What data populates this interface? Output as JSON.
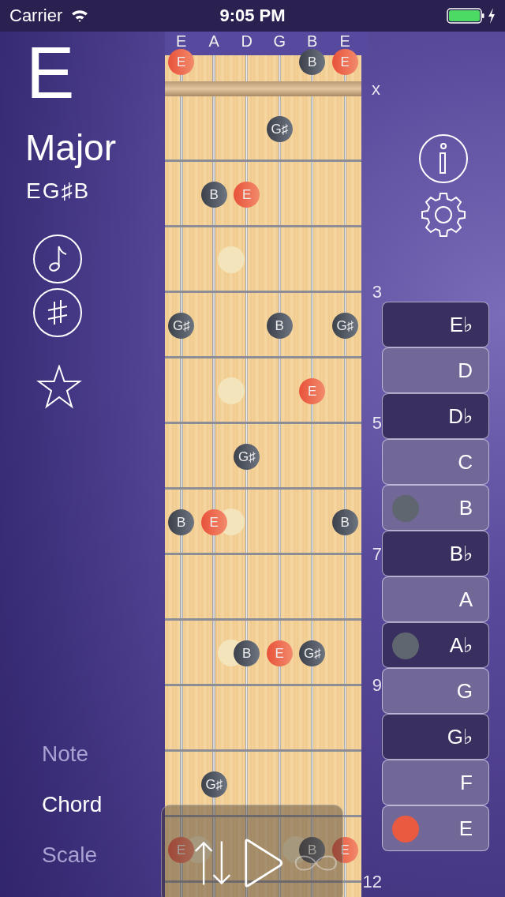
{
  "status_bar": {
    "carrier": "Carrier",
    "time": "9:05 PM"
  },
  "chord": {
    "root": "E",
    "quality": "Major",
    "notes": "EG♯B",
    "favorite": false
  },
  "modes": [
    {
      "label": "Note",
      "selected": false
    },
    {
      "label": "Chord",
      "selected": true
    },
    {
      "label": "Scale",
      "selected": false
    }
  ],
  "strings": [
    "E",
    "A",
    "D",
    "G",
    "B",
    "E"
  ],
  "open_row": {
    "mute_label": "x",
    "cells": [
      {
        "kind": "root",
        "note": "E"
      },
      {
        "kind": "empty"
      },
      {
        "kind": "empty"
      },
      {
        "kind": "empty"
      },
      {
        "kind": "tone",
        "note": "B"
      },
      {
        "kind": "root",
        "note": "E"
      }
    ]
  },
  "frets": [
    {
      "cells": [
        {
          "kind": "empty"
        },
        {
          "kind": "empty"
        },
        {
          "kind": "empty"
        },
        {
          "kind": "tone",
          "note": "G♯"
        },
        {
          "kind": "empty"
        },
        {
          "kind": "empty"
        }
      ]
    },
    {
      "cells": [
        {
          "kind": "empty"
        },
        {
          "kind": "tone",
          "note": "B"
        },
        {
          "kind": "root",
          "note": "E"
        },
        {
          "kind": "empty"
        },
        {
          "kind": "empty"
        },
        {
          "kind": "empty"
        }
      ]
    },
    {
      "inlay": true,
      "number": "3",
      "cells": [
        {
          "kind": "empty"
        },
        {
          "kind": "empty"
        },
        {
          "kind": "empty"
        },
        {
          "kind": "empty"
        },
        {
          "kind": "empty"
        },
        {
          "kind": "empty"
        }
      ]
    },
    {
      "cells": [
        {
          "kind": "tone",
          "note": "G♯"
        },
        {
          "kind": "empty"
        },
        {
          "kind": "empty"
        },
        {
          "kind": "tone",
          "note": "B"
        },
        {
          "kind": "empty"
        },
        {
          "kind": "tone",
          "note": "G♯"
        }
      ]
    },
    {
      "inlay": true,
      "number": "5",
      "cells": [
        {
          "kind": "empty"
        },
        {
          "kind": "empty"
        },
        {
          "kind": "empty"
        },
        {
          "kind": "empty"
        },
        {
          "kind": "root",
          "note": "E"
        },
        {
          "kind": "empty"
        }
      ]
    },
    {
      "cells": [
        {
          "kind": "empty"
        },
        {
          "kind": "empty"
        },
        {
          "kind": "tone",
          "note": "G♯"
        },
        {
          "kind": "empty"
        },
        {
          "kind": "empty"
        },
        {
          "kind": "empty"
        }
      ]
    },
    {
      "inlay": true,
      "number": "7",
      "cells": [
        {
          "kind": "tone",
          "note": "B"
        },
        {
          "kind": "root",
          "note": "E"
        },
        {
          "kind": "empty"
        },
        {
          "kind": "empty"
        },
        {
          "kind": "empty"
        },
        {
          "kind": "tone",
          "note": "B"
        }
      ]
    },
    {
      "cells": [
        {
          "kind": "empty"
        },
        {
          "kind": "empty"
        },
        {
          "kind": "empty"
        },
        {
          "kind": "empty"
        },
        {
          "kind": "empty"
        },
        {
          "kind": "empty"
        }
      ]
    },
    {
      "inlay": true,
      "number": "9",
      "cells": [
        {
          "kind": "empty"
        },
        {
          "kind": "empty"
        },
        {
          "kind": "tone",
          "note": "B"
        },
        {
          "kind": "root",
          "note": "E"
        },
        {
          "kind": "tone",
          "note": "G♯"
        },
        {
          "kind": "empty"
        }
      ]
    },
    {
      "cells": [
        {
          "kind": "empty"
        },
        {
          "kind": "empty"
        },
        {
          "kind": "empty"
        },
        {
          "kind": "empty"
        },
        {
          "kind": "empty"
        },
        {
          "kind": "empty"
        }
      ]
    },
    {
      "cells": [
        {
          "kind": "empty"
        },
        {
          "kind": "tone",
          "note": "G♯"
        },
        {
          "kind": "empty"
        },
        {
          "kind": "empty"
        },
        {
          "kind": "empty"
        },
        {
          "kind": "empty"
        }
      ]
    },
    {
      "inlay": true,
      "double_inlay": true,
      "number": "12",
      "cells": [
        {
          "kind": "root",
          "note": "E"
        },
        {
          "kind": "empty"
        },
        {
          "kind": "empty"
        },
        {
          "kind": "empty"
        },
        {
          "kind": "tone",
          "note": "B"
        },
        {
          "kind": "root",
          "note": "E"
        }
      ]
    }
  ],
  "playback": {
    "loop": false
  },
  "note_list": [
    {
      "label": "E♭",
      "kind": "accidental"
    },
    {
      "label": "D",
      "kind": "natural"
    },
    {
      "label": "D♭",
      "kind": "accidental"
    },
    {
      "label": "C",
      "kind": "natural"
    },
    {
      "label": "B",
      "kind": "natural",
      "color": "#5f6670"
    },
    {
      "label": "B♭",
      "kind": "accidental"
    },
    {
      "label": "A",
      "kind": "natural"
    },
    {
      "label": "A♭",
      "kind": "accidental",
      "color": "#5f6670"
    },
    {
      "label": "G",
      "kind": "natural"
    },
    {
      "label": "G♭",
      "kind": "accidental"
    },
    {
      "label": "F",
      "kind": "natural"
    },
    {
      "label": "E",
      "kind": "natural",
      "color": "#ea5a40"
    }
  ]
}
